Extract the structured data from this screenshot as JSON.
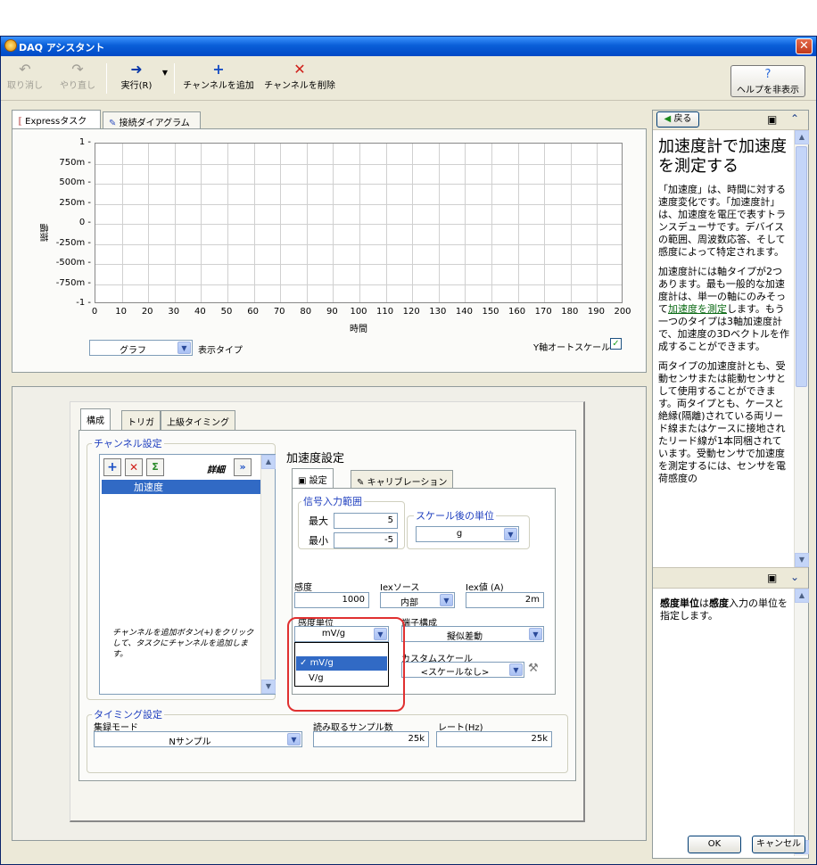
{
  "window": {
    "title": "DAQ アシスタント"
  },
  "toolbar": {
    "undo": "取り消し",
    "redo": "やり直し",
    "run": "実行(R)",
    "add_channel": "チャンネルを追加",
    "remove_channel": "チャンネルを削除",
    "hide_help": "ヘルプを非表示"
  },
  "tabs": {
    "express": "Expressタスク",
    "connection": "接続ダイアグラム"
  },
  "graph": {
    "ylabel": "振幅",
    "xlabel": "時間",
    "yticks": [
      "1",
      "750m",
      "500m",
      "250m",
      "0",
      "-250m",
      "-500m",
      "-750m",
      "-1"
    ],
    "xticks": [
      "0",
      "10",
      "20",
      "30",
      "40",
      "50",
      "60",
      "70",
      "80",
      "90",
      "100",
      "110",
      "120",
      "130",
      "140",
      "150",
      "160",
      "170",
      "180",
      "190",
      "200"
    ],
    "display_type_value": "グラフ",
    "display_type_label": "表示タイプ",
    "autoscale_label": "Y軸オートスケール"
  },
  "config": {
    "tabs": [
      "構成",
      "トリガ",
      "上級タイミング"
    ],
    "channel_group": "チャンネル設定",
    "details_label": "詳細",
    "channel_item": "加速度",
    "channel_hint": "チャンネルを追加ボタン(+)をクリックして、タスクにチャンネルを追加します。",
    "accel_title": "加速度設定",
    "subtab_settings": "設定",
    "subtab_calib": "キャリブレーション",
    "input_range_group": "信号入力範囲",
    "max_label": "最大",
    "max_value": "5",
    "min_label": "最小",
    "min_value": "-5",
    "scaled_units_group": "スケール後の単位",
    "scaled_units_value": "g",
    "sensitivity_label": "感度",
    "sensitivity_value": "1000",
    "iex_source_label": "Iexソース",
    "iex_source_value": "内部",
    "iex_value_label": "Iex値 (A)",
    "iex_value": "2m",
    "sens_units_label": "感度単位",
    "sens_units_value": "mV/g",
    "dropdown_options": [
      "mV/g",
      "V/g"
    ],
    "terminal_label": "端子構成",
    "terminal_value": "擬似差動",
    "custom_scale_label": "カスタムスケール",
    "custom_scale_value": "<スケールなし>",
    "timing_group": "タイミング設定",
    "acq_mode_label": "集録モード",
    "acq_mode_value": "Nサンプル",
    "samples_label": "読み取るサンプル数",
    "samples_value": "25k",
    "rate_label": "レート(Hz)",
    "rate_value": "25k"
  },
  "help": {
    "back": "戻る",
    "title": "加速度計で加速度を測定する",
    "p1": "「加速度」は、時間に対する速度変化です。「加速度計」は、加速度を電圧で表すトランスデューサです。デバイスの範囲、周波数応答、そして感度によって特定されます。",
    "p2a": "加速度計には軸タイプが2つあります。最も一般的な加速度計は、単一の軸にのみそって",
    "p2link": "加速度を測定",
    "p2b": "します。もう一つのタイプは3軸加速度計で、加速度の3Dベクトルを作成することができます。",
    "p3": "両タイプの加速度計とも、受動センサまたは能動センサとして使用することができます。両タイプとも、ケースと絶縁(隔離)されている両リード線またはケースに接地されたリード線が1本同梱されています。受動センサで加速度を測定するには、センサを電荷感度の",
    "desc_bold1": "感度単位",
    "desc_mid": "は",
    "desc_bold2": "感度",
    "desc_end": "入力の単位を指定します。"
  },
  "buttons": {
    "ok": "OK",
    "cancel": "キャンセル"
  }
}
